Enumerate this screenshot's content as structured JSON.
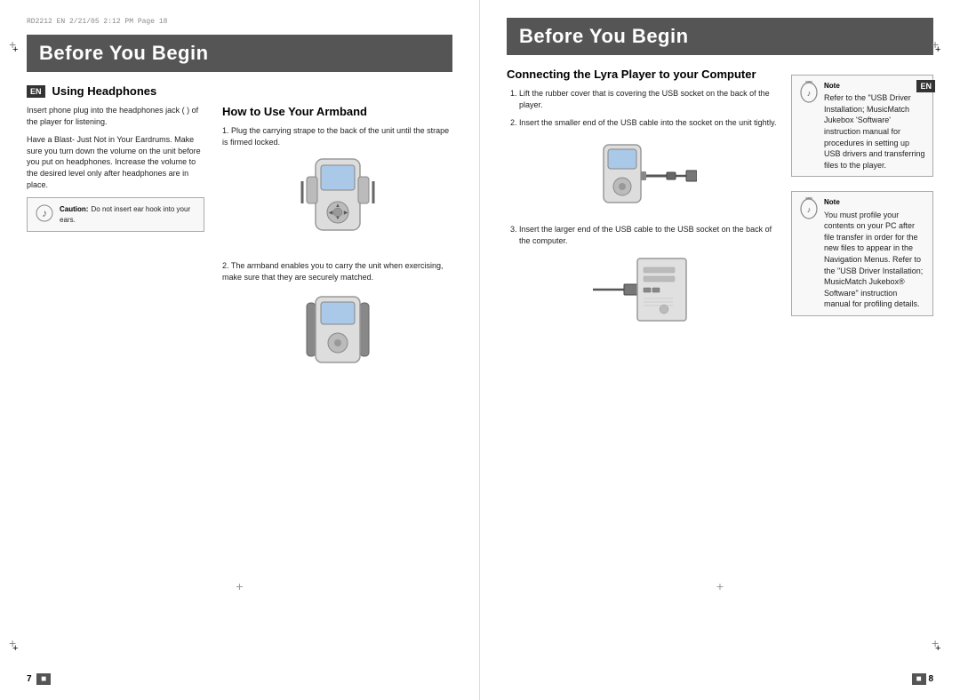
{
  "left_page": {
    "header_info": "RD2212  EN  2/21/05  2:12 PM  Page 18",
    "title": "Before You Begin",
    "en_badge": "EN",
    "section1": {
      "title": "Using Headphones",
      "para1": "Insert phone plug into the headphones jack (  ) of the player for listening.",
      "para2": "Have a Blast- Just Not in Your Eardrums. Make sure you turn down the volume on the unit before you put on headphones. Increase the volume to the desired level only after headphones are in place.",
      "caution": {
        "label": "Caution:",
        "text": "Do not insert ear hook into your ears."
      }
    },
    "section2": {
      "title": "How to Use Your Armband",
      "step1": "1. Plug the carrying strape to the back of the unit until the strape is firmed locked.",
      "step2": "2. The armband enables you to carry the unit when exercising, make sure that they are securely matched."
    },
    "page_number": "7"
  },
  "right_page": {
    "title": "Before You Begin",
    "en_badge": "EN",
    "section1": {
      "title": "Connecting the Lyra Player to your Computer",
      "steps": [
        "Lift the rubber cover that is covering the USB socket on the back of the player.",
        "Insert the smaller end of the USB cable into the socket on the unit tightly.",
        "Insert the larger end of the USB cable to the USB socket on the back of the computer."
      ]
    },
    "note1": {
      "label": "Note",
      "text": "Refer to the \"USB Driver Installation; MusicMatch Jukebox  'Software' instruction manual for procedures in setting up USB drivers and transferring files to the player."
    },
    "note2": {
      "label": "Note",
      "text": "You must profile your contents on your PC after file transfer in order for the new files to appear in the Navigation Menus. Refer to the \"USB Driver Installation; MusicMatch Jukebox® Software\" instruction manual for profiling details."
    },
    "page_number": "8"
  }
}
